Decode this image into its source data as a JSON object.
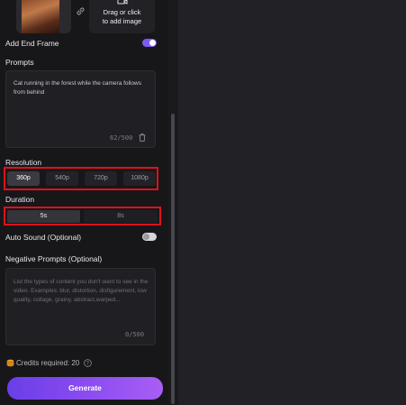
{
  "upload": {
    "text_line1": "Drag or click",
    "text_line2": "to add image"
  },
  "end_frame": {
    "label": "Add End Frame",
    "enabled": true
  },
  "prompts": {
    "label": "Prompts",
    "value": "Cat running in the forest while the camera follows from behind",
    "counter": "62/500"
  },
  "resolution": {
    "label": "Resolution",
    "options": [
      "360p",
      "540p",
      "720p",
      "1080p"
    ],
    "selected": "360p"
  },
  "duration": {
    "label": "Duration",
    "options": [
      "5s",
      "8s"
    ],
    "selected": "5s"
  },
  "auto_sound": {
    "label": "Auto Sound (Optional)",
    "enabled": false
  },
  "negative_prompts": {
    "label": "Negative Prompts (Optional)",
    "placeholder": "List the types of content you don't want to see in the video. Examples: blur, distortion, disfigurement, low quality, collage, grainy, abstract,warped...",
    "counter": "0/500"
  },
  "credits": {
    "text": "Credits required: 20"
  },
  "generate": {
    "label": "Generate"
  },
  "colors": {
    "accent": "#7c5cf0",
    "highlight_border": "#e0101a",
    "panel_bg": "#17171a"
  },
  "icons": [
    "link-icon",
    "video-plus-icon",
    "trash-icon",
    "coin-icon",
    "help-icon"
  ]
}
